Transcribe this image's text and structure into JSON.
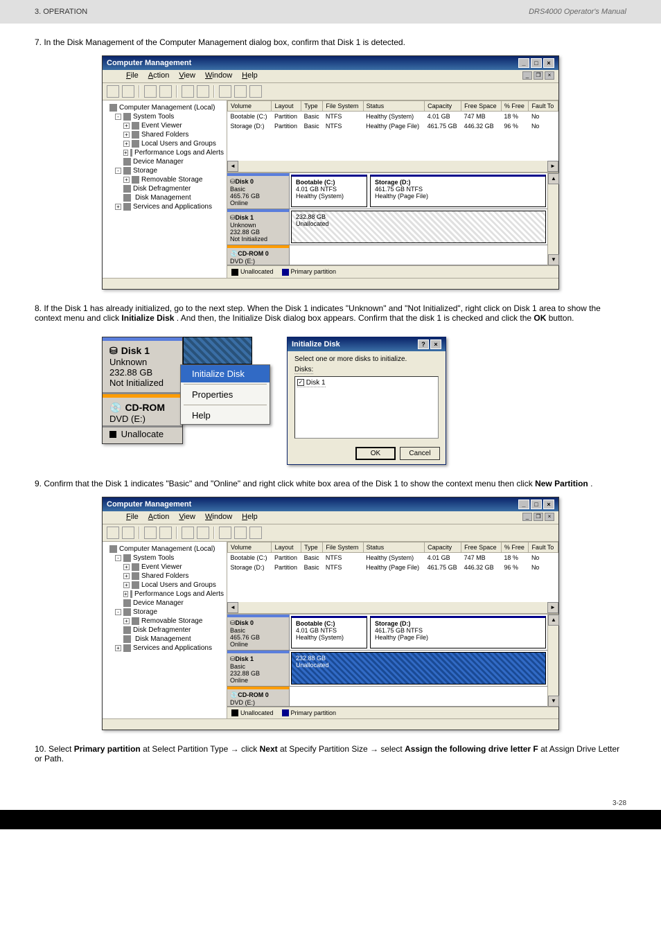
{
  "page_header": {
    "section": "3. OPERATION",
    "doc_title": "DRS4000 Operator's Manual"
  },
  "steps": {
    "s7": "7. In the Disk Management of the Computer Management dialog box, confirm that Disk 1 is detected.",
    "s8_a": "8. If the Disk 1 has already initialized, go to the next step. When the Disk 1 indicates \"Unknown\" and \"Not Initialized\", right click on Disk 1 area to show the context menu and click ",
    "s8_b": "Initialize Disk",
    "s8_c": ". And then, the Initialize Disk dialog box appears. Confirm that the disk 1 is checked and click the ",
    "s8_d": "OK",
    "s8_e": " button.",
    "s9_a": "9. Confirm that the Disk 1 indicates \"Basic\" and \"Online\" and right click white box area of the Disk 1 to show the context menu then click ",
    "s9_b": "New Partition",
    "s9_c": "."
  },
  "window": {
    "title": "Computer Management",
    "menus": {
      "file": "File",
      "action": "Action",
      "view": "View",
      "window": "Window",
      "help": "Help"
    }
  },
  "tree": {
    "root": "Computer Management (Local)",
    "systools": "System Tools",
    "event": "Event Viewer",
    "shared": "Shared Folders",
    "users": "Local Users and Groups",
    "perf": "Performance Logs and Alerts",
    "devmgr": "Device Manager",
    "storage": "Storage",
    "removable": "Removable Storage",
    "defrag": "Disk Defragmenter",
    "diskmgmt": "Disk Management",
    "services": "Services and Applications"
  },
  "vol_cols": {
    "volume": "Volume",
    "layout": "Layout",
    "type": "Type",
    "fs": "File System",
    "status": "Status",
    "capacity": "Capacity",
    "free": "Free Space",
    "pctfree": "% Free",
    "fault": "Fault To"
  },
  "volumes": [
    {
      "name": "Bootable (C:)",
      "layout": "Partition",
      "type": "Basic",
      "fs": "NTFS",
      "status": "Healthy (System)",
      "capacity": "4.01 GB",
      "free": "747 MB",
      "pctfree": "18 %",
      "fault": "No"
    },
    {
      "name": "Storage (D:)",
      "layout": "Partition",
      "type": "Basic",
      "fs": "NTFS",
      "status": "Healthy (Page File)",
      "capacity": "461.75 GB",
      "free": "446.32 GB",
      "pctfree": "96 %",
      "fault": "No"
    }
  ],
  "disk0": {
    "title": "Disk 0",
    "type": "Basic",
    "size": "465.76 GB",
    "status": "Online",
    "partC": {
      "name": "Bootable (C:)",
      "size": "4.01 GB NTFS",
      "status": "Healthy (System)"
    },
    "partD": {
      "name": "Storage (D:)",
      "size": "461.75 GB NTFS",
      "status": "Healthy (Page File)"
    }
  },
  "disk1_before": {
    "title": "Disk 1",
    "type": "Unknown",
    "size": "232.88 GB",
    "status": "Not Initialized",
    "part": {
      "size": "232.88 GB",
      "status": "Unallocated"
    }
  },
  "disk1_after": {
    "title": "Disk 1",
    "type": "Basic",
    "size": "232.88 GB",
    "status": "Online",
    "part": {
      "size": "232.88 GB",
      "status": "Unallocated"
    }
  },
  "cdrom": {
    "title": "CD-ROM 0",
    "sub": "DVD (E:)"
  },
  "legend": {
    "unalloc": "Unallocated",
    "primary": "Primary partition"
  },
  "ctx_block": {
    "d1title": "Disk 1",
    "d1type": "Unknown",
    "d1size": "232.88 GB",
    "d1status": "Not Initialized",
    "cdtitle": "CD-ROM",
    "cdsub": "DVD (E:)",
    "cdlegend": "Unallocate",
    "menu_init": "Initialize Disk",
    "menu_props": "Properties",
    "menu_help": "Help"
  },
  "init_dlg": {
    "title": "Initialize Disk",
    "instr": "Select one or more disks to initialize.",
    "disks_label": "Disks:",
    "item": "Disk 1",
    "ok": "OK",
    "cancel": "Cancel"
  },
  "closing": {
    "p1_a": "10. Select ",
    "p1_b": "Primary partition",
    "p1_c": " at Select Partition Type ",
    "arrow1": "→",
    "p1_d": " click ",
    "p1_e": "Next",
    "p1_f": " at Specify Partition Size ",
    "arrow2": "→",
    "p1_g": " select ",
    "p1_h": "Assign the following drive letter F",
    "p1_i": " at Assign Drive Letter or Path."
  },
  "page_number": "3-28",
  "footer": {
    "left": "",
    "right": ""
  }
}
